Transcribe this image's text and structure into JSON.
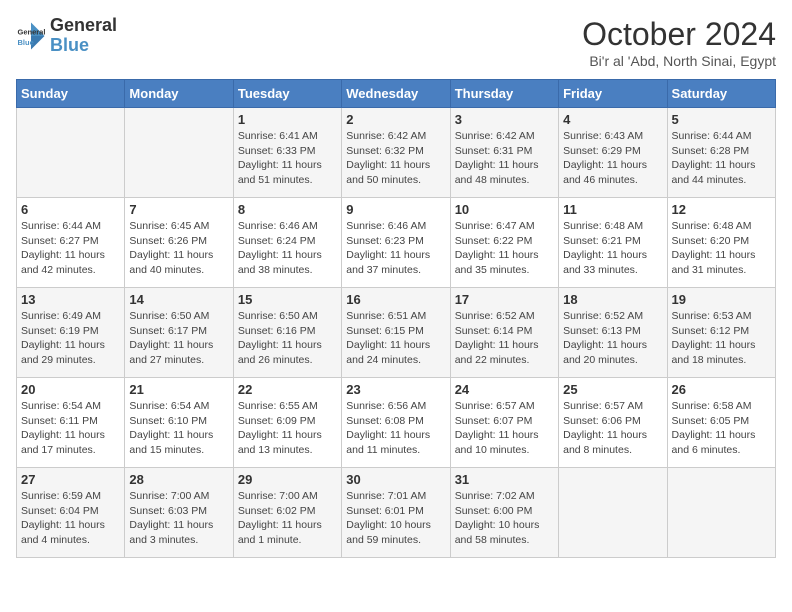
{
  "header": {
    "logo_line1": "General",
    "logo_line2": "Blue",
    "month_title": "October 2024",
    "location": "Bi'r al 'Abd, North Sinai, Egypt"
  },
  "weekdays": [
    "Sunday",
    "Monday",
    "Tuesday",
    "Wednesday",
    "Thursday",
    "Friday",
    "Saturday"
  ],
  "weeks": [
    [
      {
        "day": "",
        "info": ""
      },
      {
        "day": "",
        "info": ""
      },
      {
        "day": "1",
        "info": "Sunrise: 6:41 AM\nSunset: 6:33 PM\nDaylight: 11 hours and 51 minutes."
      },
      {
        "day": "2",
        "info": "Sunrise: 6:42 AM\nSunset: 6:32 PM\nDaylight: 11 hours and 50 minutes."
      },
      {
        "day": "3",
        "info": "Sunrise: 6:42 AM\nSunset: 6:31 PM\nDaylight: 11 hours and 48 minutes."
      },
      {
        "day": "4",
        "info": "Sunrise: 6:43 AM\nSunset: 6:29 PM\nDaylight: 11 hours and 46 minutes."
      },
      {
        "day": "5",
        "info": "Sunrise: 6:44 AM\nSunset: 6:28 PM\nDaylight: 11 hours and 44 minutes."
      }
    ],
    [
      {
        "day": "6",
        "info": "Sunrise: 6:44 AM\nSunset: 6:27 PM\nDaylight: 11 hours and 42 minutes."
      },
      {
        "day": "7",
        "info": "Sunrise: 6:45 AM\nSunset: 6:26 PM\nDaylight: 11 hours and 40 minutes."
      },
      {
        "day": "8",
        "info": "Sunrise: 6:46 AM\nSunset: 6:24 PM\nDaylight: 11 hours and 38 minutes."
      },
      {
        "day": "9",
        "info": "Sunrise: 6:46 AM\nSunset: 6:23 PM\nDaylight: 11 hours and 37 minutes."
      },
      {
        "day": "10",
        "info": "Sunrise: 6:47 AM\nSunset: 6:22 PM\nDaylight: 11 hours and 35 minutes."
      },
      {
        "day": "11",
        "info": "Sunrise: 6:48 AM\nSunset: 6:21 PM\nDaylight: 11 hours and 33 minutes."
      },
      {
        "day": "12",
        "info": "Sunrise: 6:48 AM\nSunset: 6:20 PM\nDaylight: 11 hours and 31 minutes."
      }
    ],
    [
      {
        "day": "13",
        "info": "Sunrise: 6:49 AM\nSunset: 6:19 PM\nDaylight: 11 hours and 29 minutes."
      },
      {
        "day": "14",
        "info": "Sunrise: 6:50 AM\nSunset: 6:17 PM\nDaylight: 11 hours and 27 minutes."
      },
      {
        "day": "15",
        "info": "Sunrise: 6:50 AM\nSunset: 6:16 PM\nDaylight: 11 hours and 26 minutes."
      },
      {
        "day": "16",
        "info": "Sunrise: 6:51 AM\nSunset: 6:15 PM\nDaylight: 11 hours and 24 minutes."
      },
      {
        "day": "17",
        "info": "Sunrise: 6:52 AM\nSunset: 6:14 PM\nDaylight: 11 hours and 22 minutes."
      },
      {
        "day": "18",
        "info": "Sunrise: 6:52 AM\nSunset: 6:13 PM\nDaylight: 11 hours and 20 minutes."
      },
      {
        "day": "19",
        "info": "Sunrise: 6:53 AM\nSunset: 6:12 PM\nDaylight: 11 hours and 18 minutes."
      }
    ],
    [
      {
        "day": "20",
        "info": "Sunrise: 6:54 AM\nSunset: 6:11 PM\nDaylight: 11 hours and 17 minutes."
      },
      {
        "day": "21",
        "info": "Sunrise: 6:54 AM\nSunset: 6:10 PM\nDaylight: 11 hours and 15 minutes."
      },
      {
        "day": "22",
        "info": "Sunrise: 6:55 AM\nSunset: 6:09 PM\nDaylight: 11 hours and 13 minutes."
      },
      {
        "day": "23",
        "info": "Sunrise: 6:56 AM\nSunset: 6:08 PM\nDaylight: 11 hours and 11 minutes."
      },
      {
        "day": "24",
        "info": "Sunrise: 6:57 AM\nSunset: 6:07 PM\nDaylight: 11 hours and 10 minutes."
      },
      {
        "day": "25",
        "info": "Sunrise: 6:57 AM\nSunset: 6:06 PM\nDaylight: 11 hours and 8 minutes."
      },
      {
        "day": "26",
        "info": "Sunrise: 6:58 AM\nSunset: 6:05 PM\nDaylight: 11 hours and 6 minutes."
      }
    ],
    [
      {
        "day": "27",
        "info": "Sunrise: 6:59 AM\nSunset: 6:04 PM\nDaylight: 11 hours and 4 minutes."
      },
      {
        "day": "28",
        "info": "Sunrise: 7:00 AM\nSunset: 6:03 PM\nDaylight: 11 hours and 3 minutes."
      },
      {
        "day": "29",
        "info": "Sunrise: 7:00 AM\nSunset: 6:02 PM\nDaylight: 11 hours and 1 minute."
      },
      {
        "day": "30",
        "info": "Sunrise: 7:01 AM\nSunset: 6:01 PM\nDaylight: 10 hours and 59 minutes."
      },
      {
        "day": "31",
        "info": "Sunrise: 7:02 AM\nSunset: 6:00 PM\nDaylight: 10 hours and 58 minutes."
      },
      {
        "day": "",
        "info": ""
      },
      {
        "day": "",
        "info": ""
      }
    ]
  ]
}
